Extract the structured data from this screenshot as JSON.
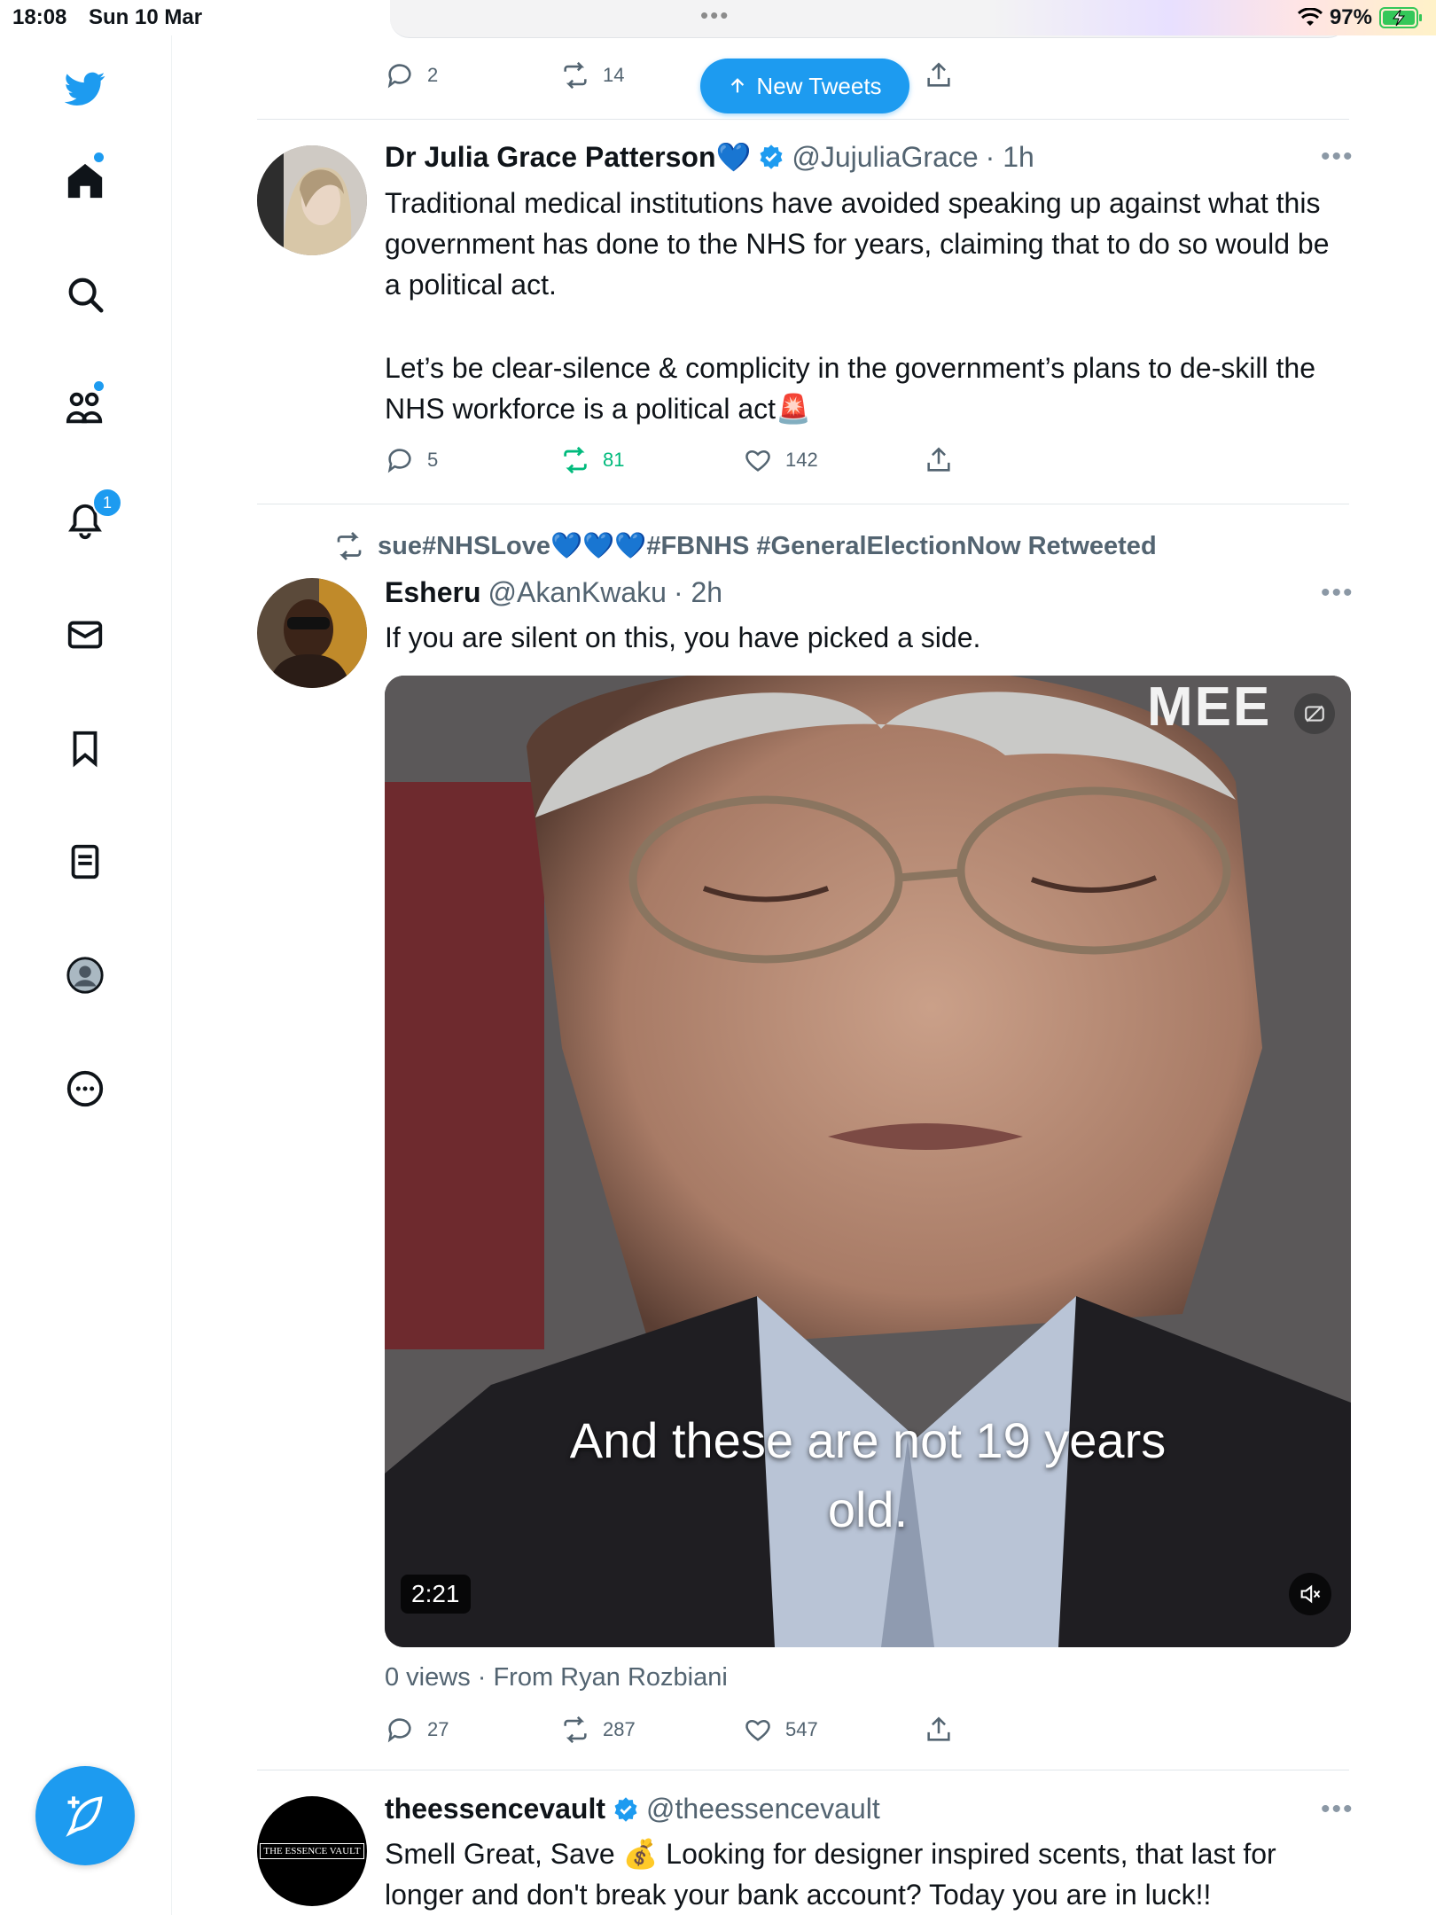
{
  "status_bar": {
    "time": "18:08",
    "date": "Sun 10 Mar",
    "battery": "97%"
  },
  "new_tweets_label": "New Tweets",
  "prev_tweet": {
    "replies": "2",
    "retweets": "14"
  },
  "sidebar": {
    "notifications_badge": "1"
  },
  "tweets": [
    {
      "name": "Dr Julia Grace Patterson💙",
      "handle": "@JujuliaGrace",
      "time": "· 1h",
      "body1": "Traditional medical institutions have avoided speaking up against what this government has done to the NHS for years, claiming that to do so would be a political act.",
      "body2": "Let’s be clear-silence & complicity in the government’s plans to de-skill the NHS workforce is a political act🚨",
      "replies": "5",
      "retweets": "81",
      "likes": "142"
    },
    {
      "retweeted_by": "sue#NHSLove💙💙💙#FBNHS #GeneralElectionNow Retweeted",
      "name": "Esheru",
      "handle": "@AkanKwaku",
      "time": "· 2h",
      "body": "If you are silent on this, you have picked a side.",
      "media_logo": "MEE",
      "caption_line1": "And these are not 19 years",
      "caption_line2": "old.",
      "duration": "2:21",
      "meta": "0 views · From Ryan Rozbiani",
      "replies": "27",
      "retweets": "287",
      "likes": "547"
    },
    {
      "name": "theessencevault",
      "handle": "@theessencevault",
      "avatar_text": "THE ESSENCE VAULT",
      "body": "Smell Great, Save 💰 Looking for designer inspired scents, that last for longer and don't break your bank account? Today you are in luck!!"
    }
  ],
  "colors": {
    "accent": "#1d9bf0",
    "retweet_active": "#00ba7c",
    "text_secondary": "#536471"
  }
}
